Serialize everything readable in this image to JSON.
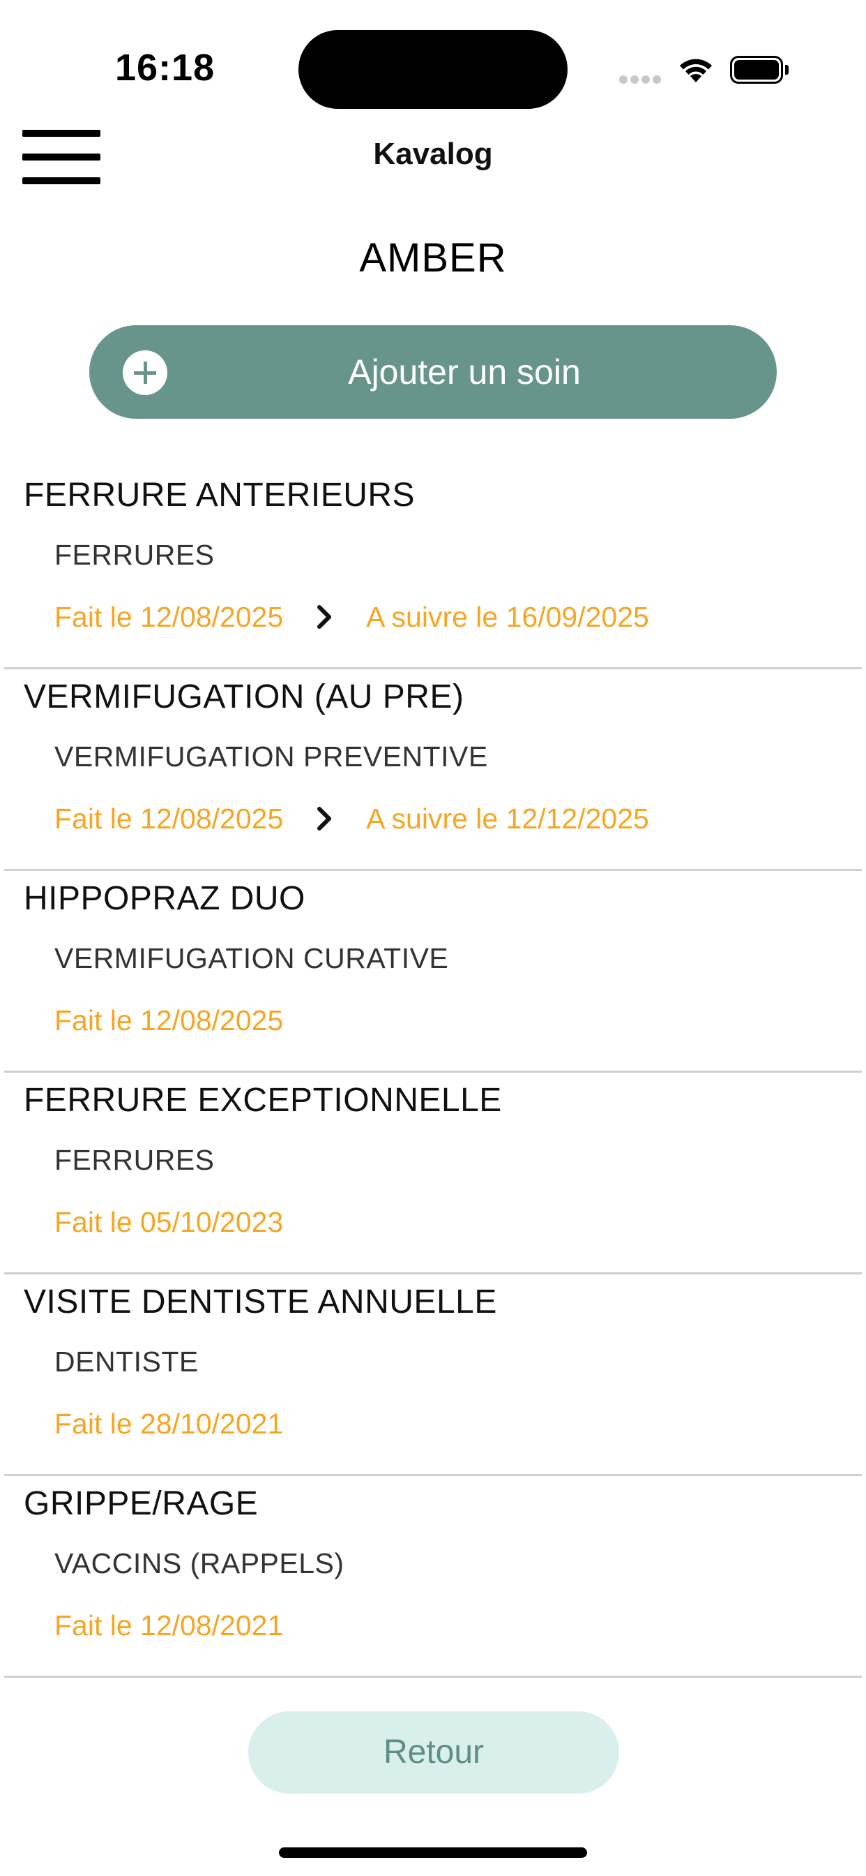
{
  "status_bar": {
    "time": "16:18",
    "icons": [
      "signal-icon",
      "wifi-icon",
      "battery-icon"
    ]
  },
  "header": {
    "title": "Kavalog",
    "menu_icon": "hamburger-menu-icon"
  },
  "horse": {
    "name": "AMBER"
  },
  "add_care": {
    "label": "Ajouter un soin",
    "icon": "plus-circle-icon"
  },
  "care_items": [
    {
      "name": "FERRURE ANTERIEURS",
      "category": "FERRURES",
      "done": "Fait le 12/08/2025",
      "next": "A suivre le 16/09/2025"
    },
    {
      "name": "VERMIFUGATION (AU PRE)",
      "category": "VERMIFUGATION PREVENTIVE",
      "done": "Fait le 12/08/2025",
      "next": "A suivre le 12/12/2025"
    },
    {
      "name": "HIPPOPRAZ DUO",
      "category": "VERMIFUGATION CURATIVE",
      "done": "Fait le 12/08/2025",
      "next": ""
    },
    {
      "name": "FERRURE EXCEPTIONNELLE",
      "category": "FERRURES",
      "done": "Fait le 05/10/2023",
      "next": ""
    },
    {
      "name": "VISITE DENTISTE ANNUELLE",
      "category": "DENTISTE",
      "done": "Fait le 28/10/2021",
      "next": ""
    },
    {
      "name": "GRIPPE/RAGE",
      "category": "VACCINS (RAPPELS)",
      "done": "Fait le 12/08/2021",
      "next": ""
    }
  ],
  "back": {
    "label": "Retour"
  },
  "colors": {
    "accent": "#67958c",
    "date_text": "#f5a623",
    "back_button_bg": "#d9efec",
    "back_button_text": "#5f8e86"
  }
}
